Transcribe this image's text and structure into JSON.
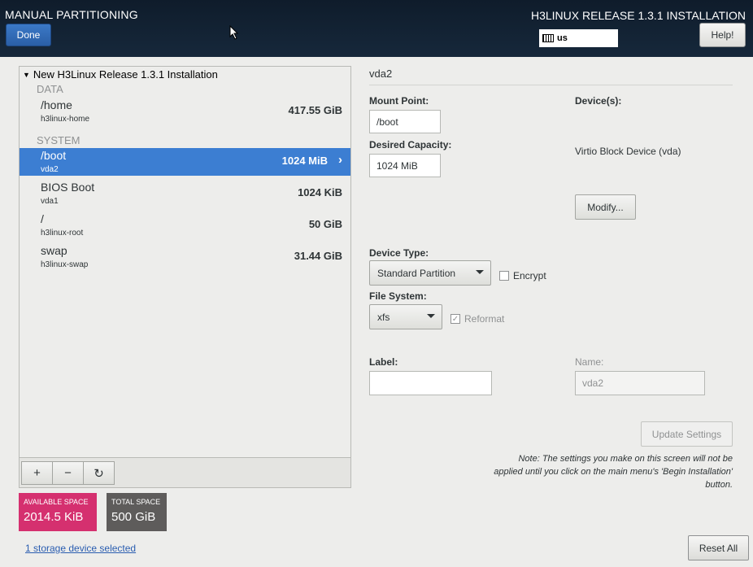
{
  "header": {
    "title": "MANUAL PARTITIONING",
    "done_label": "Done",
    "release": "H3LINUX RELEASE 1.3.1 INSTALLATION",
    "keyboard_layout": "us",
    "help_label": "Help!"
  },
  "tree": {
    "title": "New H3Linux Release 1.3.1 Installation",
    "groups": {
      "data": "DATA",
      "system": "SYSTEM"
    },
    "partitions": [
      {
        "name": "/home",
        "device": "h3linux-home",
        "size": "417.55 GiB"
      },
      {
        "name": "/boot",
        "device": "vda2",
        "size": "1024 MiB",
        "selected": true
      },
      {
        "name": "BIOS Boot",
        "device": "vda1",
        "size": "1024 KiB"
      },
      {
        "name": "/",
        "device": "h3linux-root",
        "size": "50 GiB"
      },
      {
        "name": "swap",
        "device": "h3linux-swap",
        "size": "31.44 GiB"
      }
    ],
    "toolbar": {
      "add": "+",
      "remove": "−",
      "refresh": "↻"
    }
  },
  "space": {
    "available_label": "AVAILABLE SPACE",
    "available_value": "2014.5 KiB",
    "total_label": "TOTAL SPACE",
    "total_value": "500 GiB"
  },
  "storage_link": "1 storage device selected",
  "reset_label": "Reset All",
  "detail": {
    "title": "vda2",
    "mount_point_label": "Mount Point:",
    "mount_point_value": "/boot",
    "capacity_label": "Desired Capacity:",
    "capacity_value": "1024 MiB",
    "devices_label": "Device(s):",
    "device_name": "Virtio Block Device (vda)",
    "modify_label": "Modify...",
    "device_type_label": "Device Type:",
    "device_type_value": "Standard Partition",
    "encrypt_label": "Encrypt",
    "filesystem_label": "File System:",
    "filesystem_value": "xfs",
    "reformat_label": "Reformat",
    "label_label": "Label:",
    "label_value": "",
    "name_label": "Name:",
    "name_value": "vda2",
    "update_label": "Update Settings",
    "note": "Note:  The settings you make on this screen will not be applied until you click on the main menu's 'Begin Installation' button."
  }
}
